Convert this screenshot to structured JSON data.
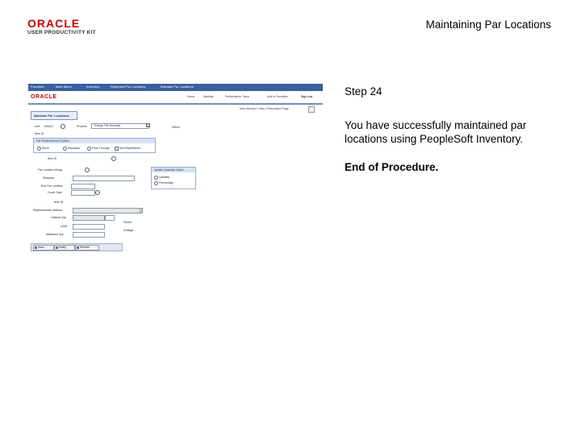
{
  "header": {
    "logo_brand": "ORACLE",
    "logo_sub": "USER PRODUCTIVITY KIT",
    "doc_title": "Maintaining Par Locations"
  },
  "screenshot": {
    "nav": [
      "Favorites",
      "Main Menu",
      "Inventory",
      "Replenish Par Locations",
      "Maintain Par Locations"
    ],
    "brand": "ORACLE",
    "top_links": [
      "Home",
      "Worklist",
      "Performance Trace",
      "Add to Favorites",
      "Sign out"
    ],
    "page_links": "New Window | Help | Personalize Page",
    "tab": "Maintain Par Locations",
    "fields": {
      "unit": "Unit",
      "unit_value": "US010",
      "process": "Process",
      "process_value": "Change Par Amounts",
      "select": "Select",
      "item_id": "Item ID",
      "par_option_header": "Par Replenishment Option",
      "par_opts": [
        "Stock",
        "Stockless",
        "Flow-Through",
        "Not Replenished"
      ],
      "item_id2": "Item ID",
      "par_location_group": "Par Location Group",
      "required": "Required",
      "end_location": "End Par Location",
      "count_type": "Count Type",
      "item_id3": "Item ID",
      "replenishment_method": "Replenishment Method",
      "optimal_qty": "Optimal Qty",
      "uom": "UOM",
      "max_qty": "Maximum Qty",
      "update_header": "Update Quantity Option",
      "update_opts": [
        "Quantity",
        "Percentage"
      ],
      "factor": "Factor",
      "change": "Change"
    },
    "buttons": [
      "Save",
      "Notify",
      "Refresh"
    ]
  },
  "content": {
    "step": "Step 24",
    "message": "You have successfully maintained par locations using PeopleSoft Inventory.",
    "end": "End of Procedure."
  }
}
